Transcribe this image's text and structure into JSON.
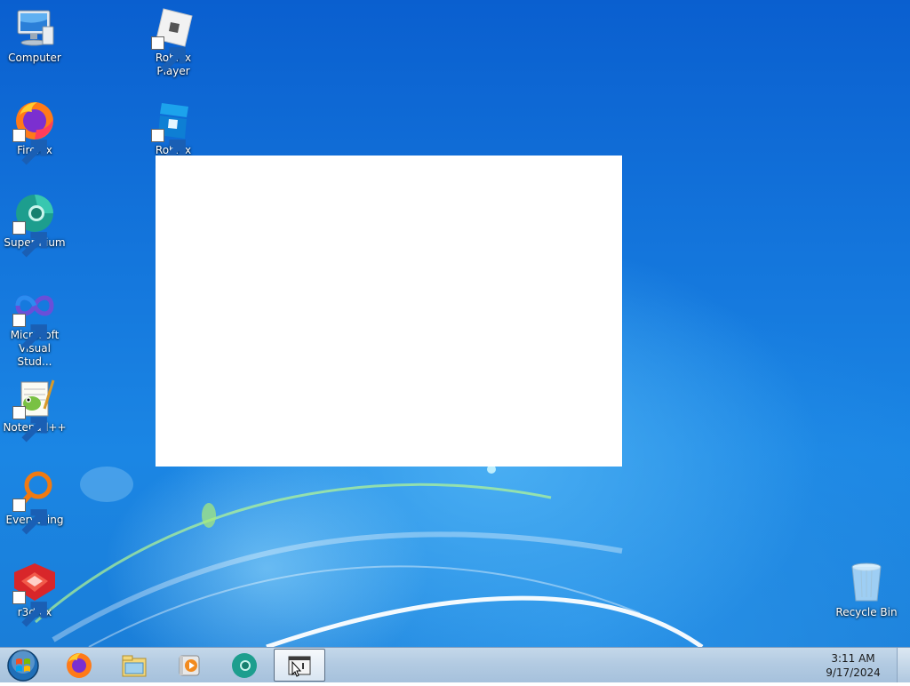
{
  "desktop_icons": {
    "computer": "Computer",
    "roblox_player": "Roblox Player",
    "firefox": "Firefox",
    "roblox_studio": "Roblox Studio",
    "supermium": "Supermium",
    "visual_studio_line1": "Microsoft",
    "visual_studio_line2": "Visual Stud...",
    "notepadpp": "Notepad++",
    "everything": "Everything",
    "r3dfox": "r3dfox",
    "recycle_bin": "Recycle Bin"
  },
  "taskbar": {
    "pinned": [
      "firefox-icon",
      "file-explorer-icon",
      "media-player-icon",
      "supermium-icon",
      "window-app-icon"
    ],
    "active_index": 4
  },
  "clock": {
    "time": "3:11 AM",
    "date": "9/17/2024"
  },
  "colors": {
    "wallpaper_top": "#0a5fcf",
    "wallpaper_bottom": "#1a7ed8",
    "taskbar": "#b3cbe2"
  }
}
